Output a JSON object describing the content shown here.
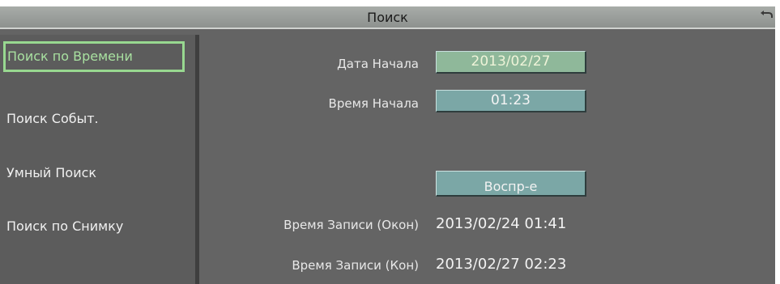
{
  "window": {
    "title": "Поиск",
    "back_icon": "back-arrow-icon"
  },
  "sidebar": {
    "items": [
      {
        "label": "Поиск по Времени",
        "active": true
      },
      {
        "label": "Поиск Событ."
      },
      {
        "label": "Умный Поиск"
      },
      {
        "label": "Поиск по Снимку"
      }
    ]
  },
  "main": {
    "start_date_label": "Дата Начала",
    "start_date_value": "2013/02/27",
    "start_time_label": "Время Начала",
    "start_time_value": "01:23",
    "play_button": "Воспр-е",
    "record_start_label": "Время Записи (Окон)",
    "record_start_value": "2013/02/24  01:41",
    "record_end_label": "Время Записи (Кон)",
    "record_end_value": "2013/02/27  02:23"
  },
  "colors": {
    "accent": "#98d890",
    "field": "#7ba7a6",
    "background": "#646464"
  }
}
